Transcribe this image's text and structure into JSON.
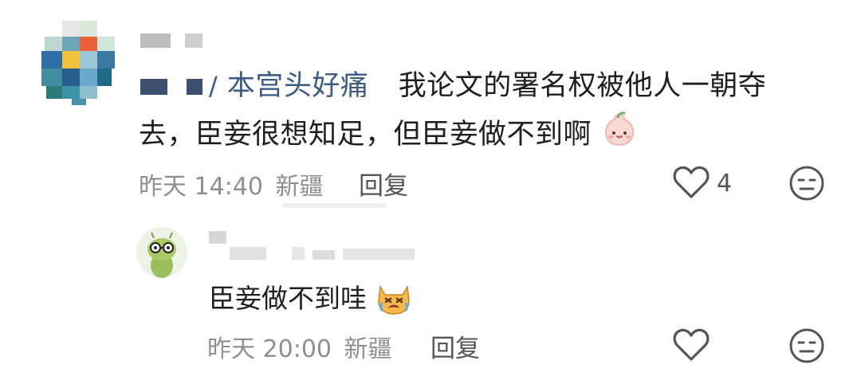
{
  "colors": {
    "mention": "#3b5a86",
    "meta": "#8f8f8f",
    "text": "#1f1f1f",
    "icon": "#555555"
  },
  "comment": {
    "mention": "本宫头好痛",
    "text_line1": "我论文的署名权被他人一朝夺",
    "text_line2": "去，臣妾很想知足，但臣妾做不到啊",
    "emoji": "peach-face-emoji",
    "time": "昨天 14:40",
    "location": "新疆",
    "reply_label": "回复",
    "likes": "4"
  },
  "reply": {
    "text": "臣妾做不到哇",
    "emoji": "crying-cat-emoji",
    "time": "昨天 20:00",
    "location": "新疆",
    "reply_label": "回复"
  },
  "icons": {
    "like": "heart-icon",
    "dislike": "meh-face-icon"
  }
}
